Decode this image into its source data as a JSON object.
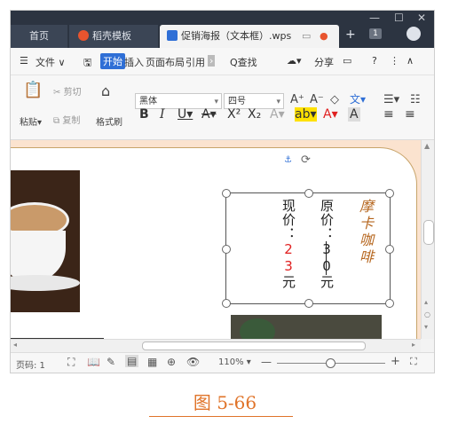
{
  "colors": {
    "accent": "#2f6fd6",
    "caption": "#e0742a",
    "price_red": "#e02020",
    "brand_brown": "#b5651d"
  },
  "tabs": {
    "home": "首页",
    "template": "稻壳模板",
    "document": "促销海报（文本框）.wps"
  },
  "menu": {
    "file": "文件",
    "start": "开始",
    "insert": "插入",
    "layout": "页面布局",
    "reference": "引用",
    "search": "Q查找",
    "share": "分享"
  },
  "ribbon": {
    "paste": "粘贴",
    "cut": "剪切",
    "copy": "复制",
    "format_painter": "格式刷",
    "font_name": "黑体",
    "font_size": "四号"
  },
  "textbox": {
    "current_price_col": [
      "现",
      "价",
      "：",
      "23",
      "元"
    ],
    "original_price_col": [
      "原",
      "价",
      "：",
      "30",
      "元"
    ],
    "brand_col": [
      "摩",
      "卡",
      "咖",
      "啡"
    ]
  },
  "status": {
    "page": "页码: 1",
    "zoom": "110%"
  },
  "caption": "图 5-66"
}
